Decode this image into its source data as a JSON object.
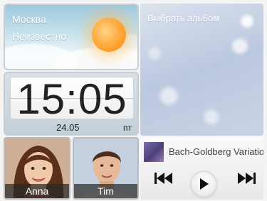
{
  "weather": {
    "city": "Москва",
    "condition": "Неизвестно",
    "icon": "sun-icon"
  },
  "clock": {
    "time": "15:05",
    "date": "24.05",
    "weekday": "пт"
  },
  "album": {
    "title": "Выбрать альбом"
  },
  "contacts": [
    {
      "name": "Anna",
      "icon": "contact-photo"
    },
    {
      "name": "Tim",
      "icon": "contact-photo"
    }
  ],
  "player": {
    "track": "Bach-Goldberg Variations",
    "prev_icon": "skip-previous-icon",
    "play_icon": "play-icon",
    "next_icon": "skip-next-icon"
  }
}
